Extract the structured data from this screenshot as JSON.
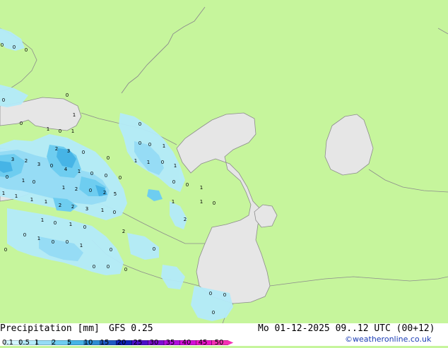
{
  "footer": {
    "title": "Precipitation [mm]",
    "model": "GFS 0.25",
    "datetime": "Mo 01-12-2025 09..12 UTC (00+12)",
    "copyright": "©weatheronline.co.uk"
  },
  "legend": {
    "labels": [
      "0.1",
      "0.5",
      "1",
      "2",
      "5",
      "10",
      "15",
      "20",
      "25",
      "30",
      "35",
      "40",
      "45",
      "50"
    ],
    "colors": [
      "#d2f5ff",
      "#b4ebfa",
      "#96dcf5",
      "#6ecdf0",
      "#46b4e6",
      "#2d8cd2",
      "#1e5ac3",
      "#0f23b4",
      "#4b0fc8",
      "#7d0fd2",
      "#af0fdc",
      "#d20fd7",
      "#eb14c8",
      "#f532b4"
    ]
  },
  "map": {
    "land_color": "#c6f59c",
    "sea_color": "#e6e6e6",
    "border_color": "#8c8c8c",
    "values": [
      "0",
      "0",
      "0",
      "0",
      "0",
      "1",
      "0",
      "1",
      "0",
      "1",
      "2",
      "3",
      "0",
      "0",
      "0",
      "0",
      "0",
      "0",
      "1",
      "1",
      "1",
      "0",
      "1",
      "3",
      "2",
      "3",
      "0",
      "4",
      "1",
      "0",
      "0",
      "0",
      "1",
      "0",
      "1",
      "2",
      "0",
      "2",
      "5",
      "1",
      "1",
      "1",
      "1",
      "2",
      "2",
      "3",
      "1",
      "0",
      "0",
      "0",
      "1",
      "1",
      "1",
      "0",
      "1",
      "0",
      "1",
      "0",
      "2",
      "2",
      "0",
      "1",
      "0",
      "0",
      "1",
      "0",
      "0",
      "0",
      "0",
      "0",
      "0",
      "0",
      "0",
      "0"
    ]
  }
}
